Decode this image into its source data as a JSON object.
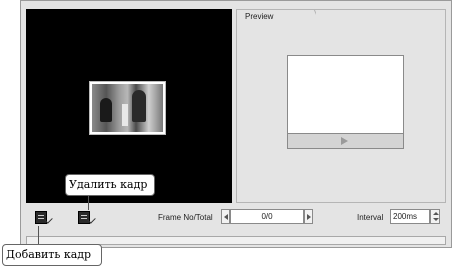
{
  "preview": {
    "title": "Preview"
  },
  "toolbar": {
    "frame_label": "Frame No/Total",
    "frame_value": "0/0",
    "interval_label": "Interval",
    "interval_value": "200ms"
  },
  "callouts": {
    "delete_frame": "Удалить кадр",
    "add_frame": "Добавить кадр"
  },
  "icons": {
    "add_frame": "add-frame-icon",
    "delete_frame": "delete-frame-icon",
    "play": "play-icon"
  },
  "colors": {
    "panel_bg": "#e4e4e4",
    "frame_area": "#000000",
    "preview_area": "#ffffff"
  }
}
